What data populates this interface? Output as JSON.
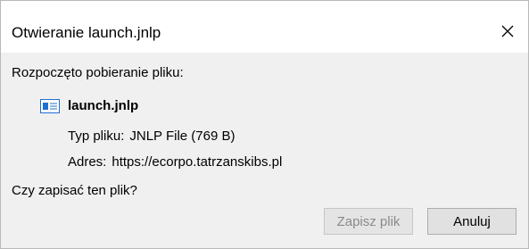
{
  "dialog": {
    "title": "Otwieranie launch.jnlp",
    "close_icon": "close-icon"
  },
  "content": {
    "heading": "Rozpoczęto pobieranie pliku:",
    "file_icon": "jnlp-file-icon",
    "file_name": "launch.jnlp",
    "type_label": "Typ pliku:",
    "type_value": "JNLP File (769 B)",
    "address_label": "Adres:",
    "address_value": "https://ecorpo.tatrzanskibs.pl",
    "question": "Czy zapisać ten plik?"
  },
  "buttons": {
    "save_label": "Zapisz plik",
    "save_enabled": false,
    "cancel_label": "Anuluj"
  },
  "colors": {
    "body_background": "#f0f0f0",
    "disabled_text": "#8a8a8a",
    "icon_blue": "#1f6fd1"
  }
}
